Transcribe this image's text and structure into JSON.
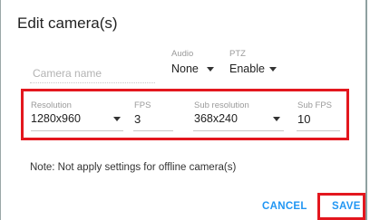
{
  "dialog": {
    "title": "Edit camera(s)"
  },
  "fields": {
    "camera_name": {
      "placeholder": "Camera name",
      "value": ""
    },
    "audio": {
      "label": "Audio",
      "value": "None"
    },
    "ptz": {
      "label": "PTZ",
      "value": "Enable"
    },
    "resolution": {
      "label": "Resolution",
      "value": "1280x960"
    },
    "fps": {
      "label": "FPS",
      "value": "3"
    },
    "sub_resolution": {
      "label": "Sub resolution",
      "value": "368x240"
    },
    "sub_fps": {
      "label": "Sub FPS",
      "value": "10"
    }
  },
  "note": "Note: Not apply settings for offline camera(s)",
  "actions": {
    "cancel": "CANCEL",
    "save": "SAVE"
  },
  "colors": {
    "accent": "#2196f3",
    "highlight": "#e3171e"
  }
}
